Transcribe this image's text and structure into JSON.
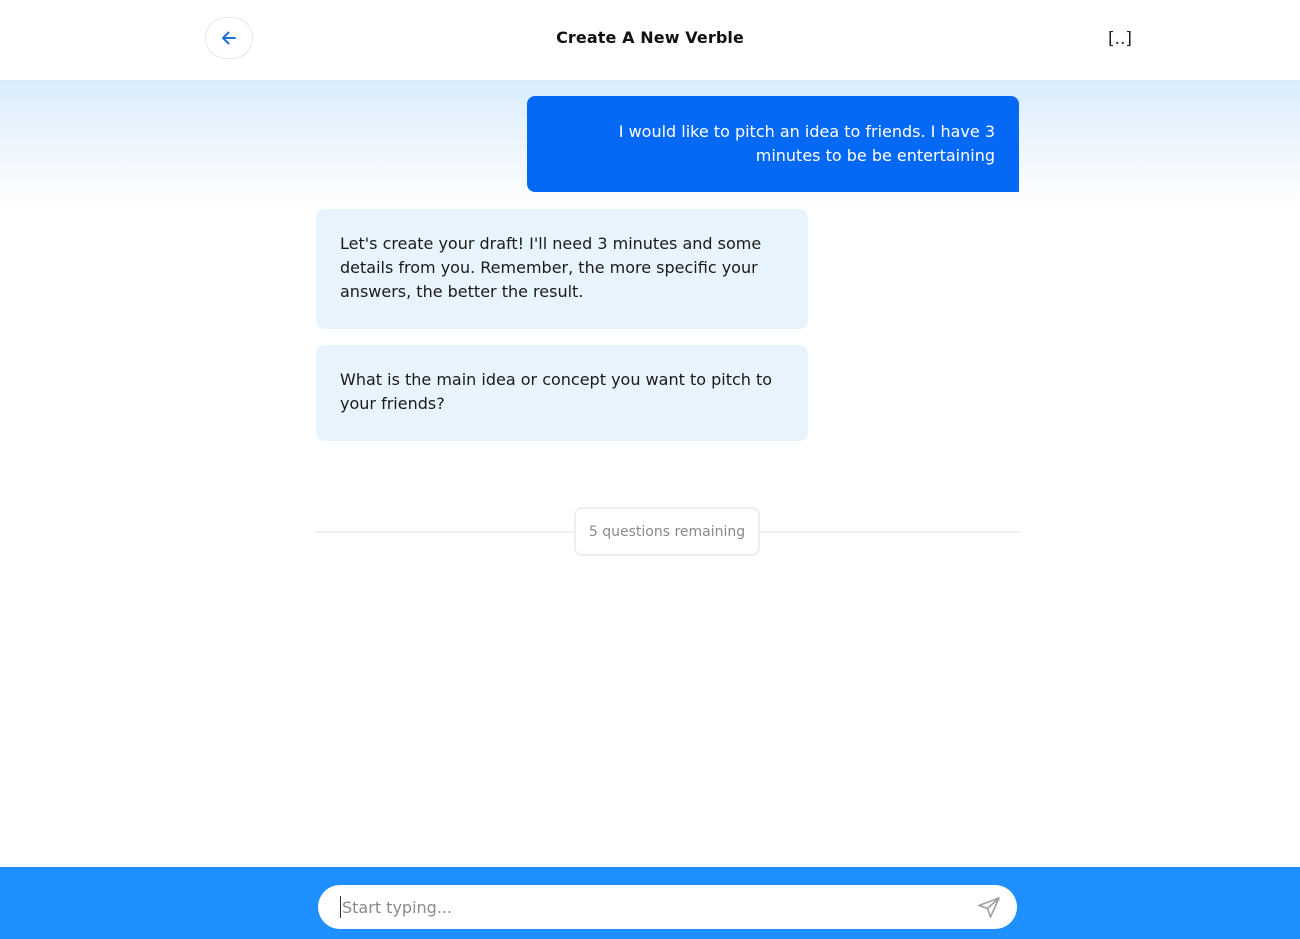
{
  "header": {
    "title": "Create A New Verble",
    "menu_label": "[..]",
    "back_icon": "arrow-left-icon"
  },
  "chat": {
    "messages": [
      {
        "role": "user",
        "text": "I would like to pitch an idea to friends. I have 3 minutes to be be entertaining"
      },
      {
        "role": "assistant",
        "text": "Let's create your draft! I'll need 3 minutes and some details from you. Remember, the more specific your answers, the better the result."
      },
      {
        "role": "assistant",
        "text": "What is the main idea or concept you want to pitch to your friends?"
      }
    ],
    "remaining_label": "5 questions remaining"
  },
  "composer": {
    "placeholder": "Start typing...",
    "value": "",
    "send_icon": "send-icon"
  },
  "colors": {
    "accent": "#0669f5",
    "footer": "#1e90ff",
    "bot_bubble": "#e8f4fd"
  }
}
